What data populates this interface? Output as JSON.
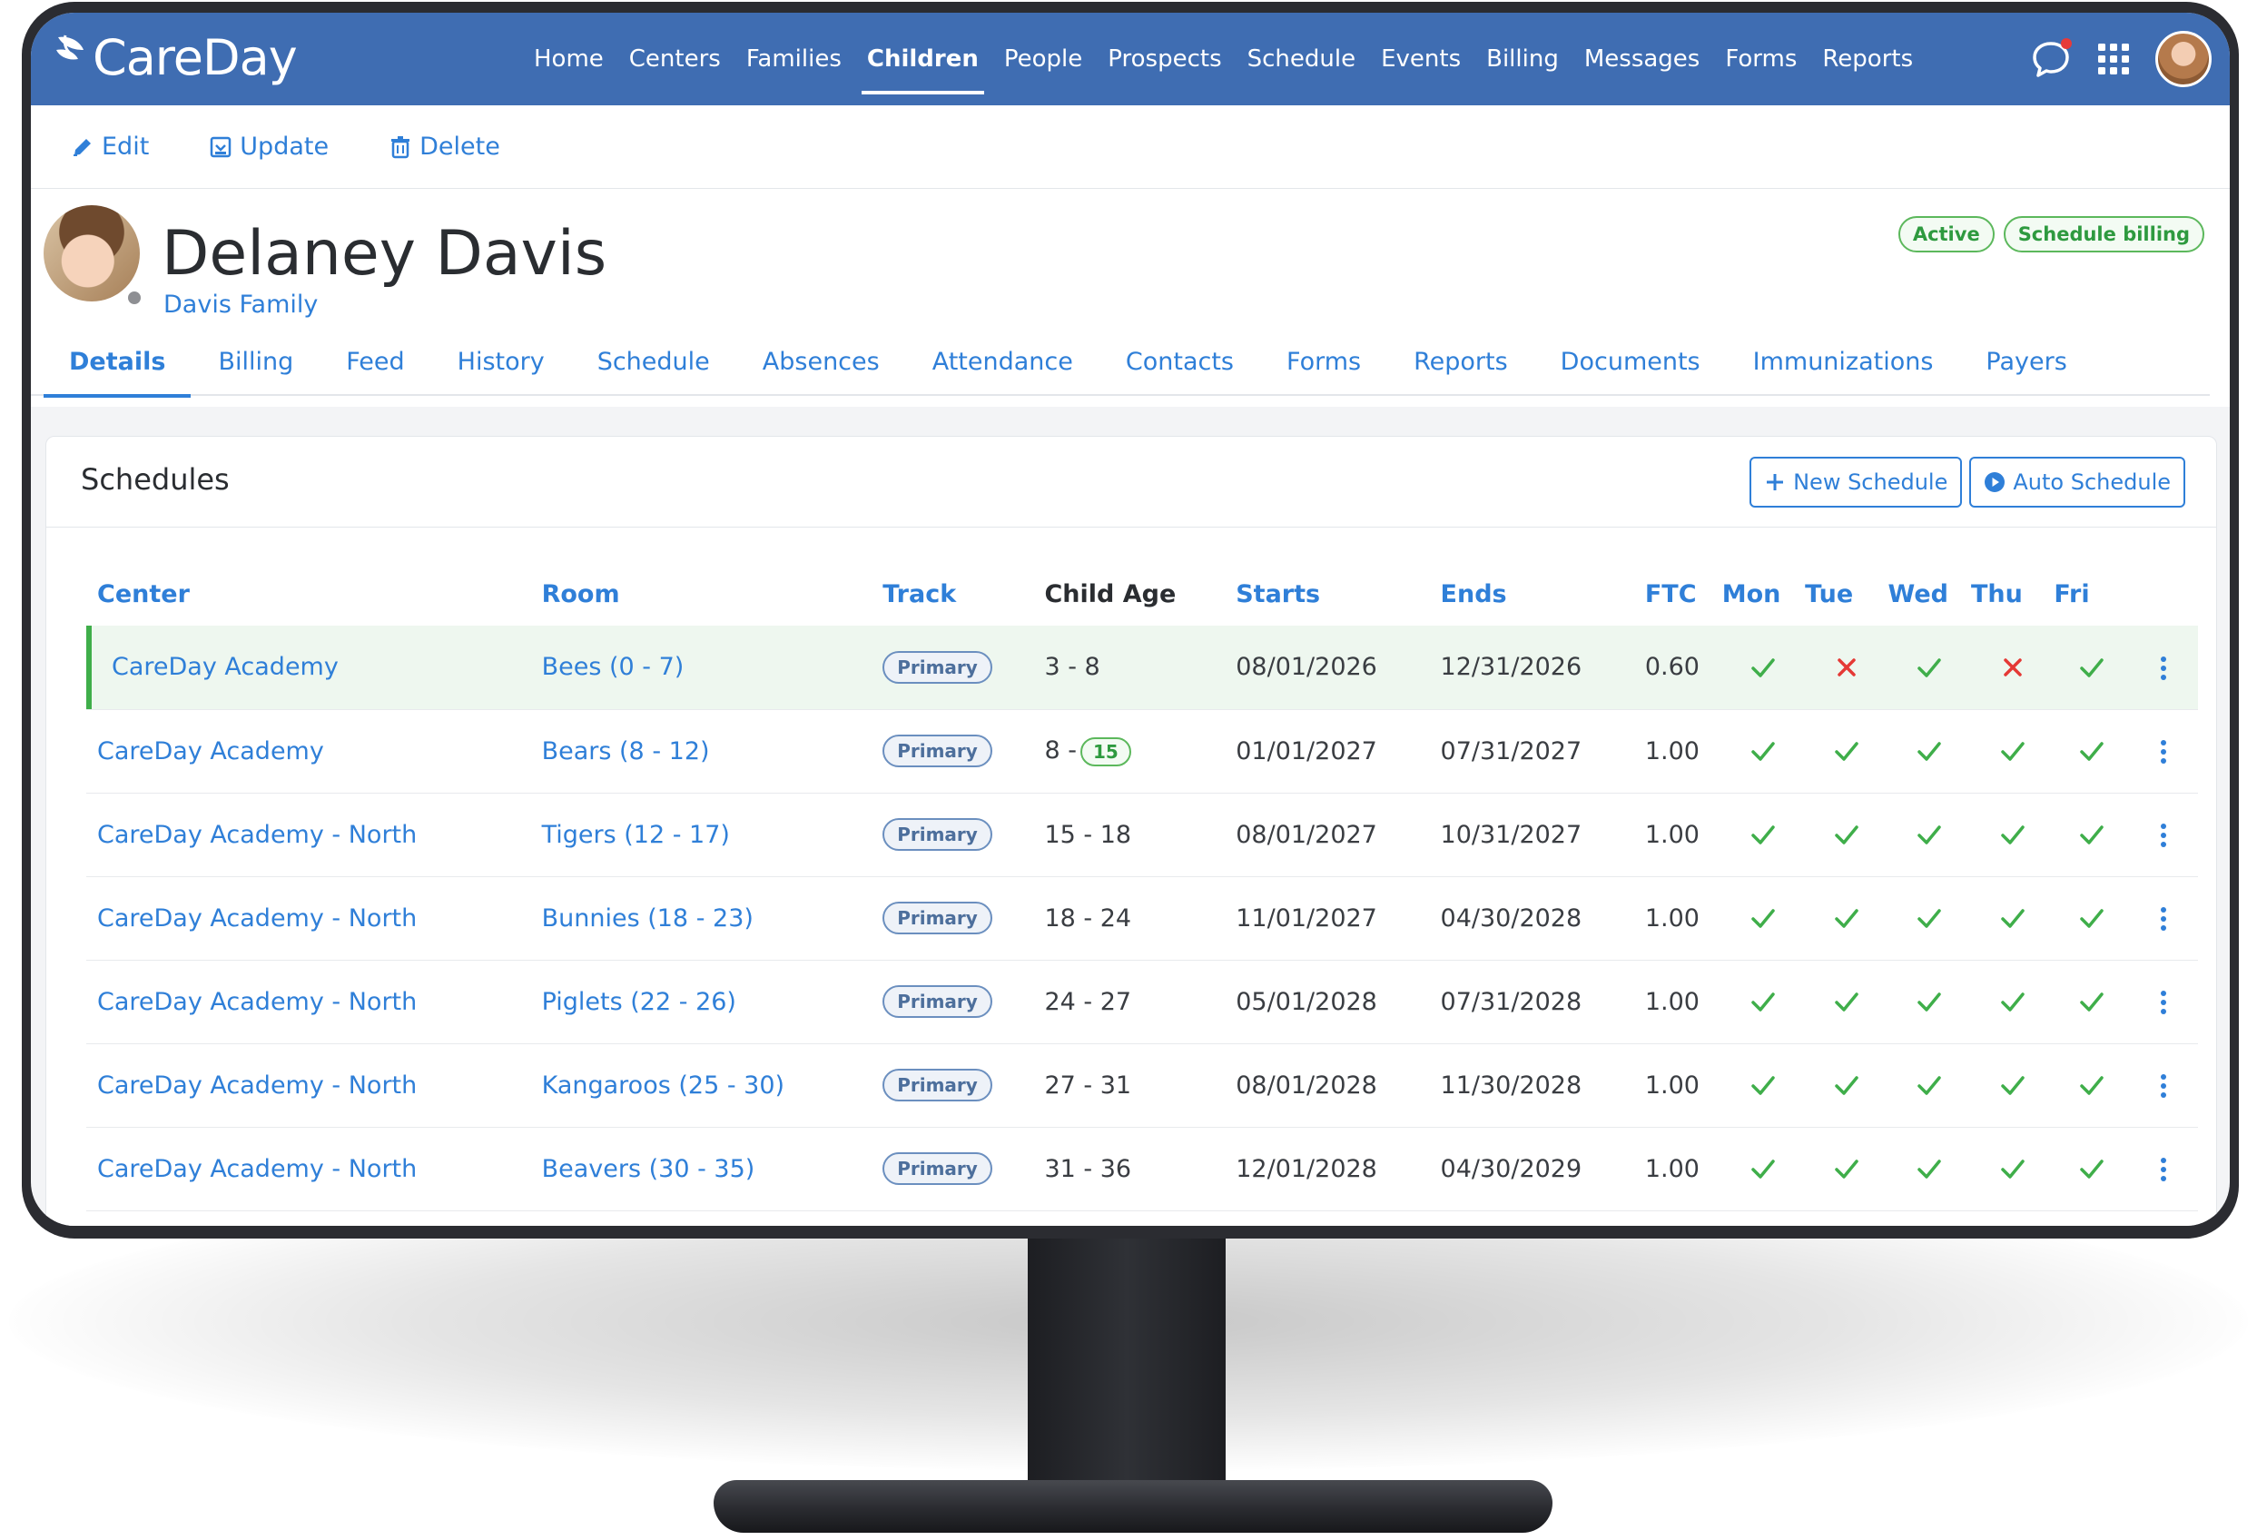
{
  "app": {
    "brand": "CareDay",
    "accent_color": "#3f6db2",
    "link_color": "#2f7fd8",
    "success_color": "#3fae4a",
    "danger_color": "#e53935"
  },
  "nav": {
    "items": [
      {
        "label": "Home",
        "active": false
      },
      {
        "label": "Centers",
        "active": false
      },
      {
        "label": "Families",
        "active": false
      },
      {
        "label": "Children",
        "active": true
      },
      {
        "label": "People",
        "active": false
      },
      {
        "label": "Prospects",
        "active": false
      },
      {
        "label": "Schedule",
        "active": false
      },
      {
        "label": "Events",
        "active": false
      },
      {
        "label": "Billing",
        "active": false
      },
      {
        "label": "Messages",
        "active": false
      },
      {
        "label": "Forms",
        "active": false
      },
      {
        "label": "Reports",
        "active": false
      }
    ],
    "icons": [
      "chat-icon",
      "apps-grid-icon",
      "user-avatar"
    ]
  },
  "actions": {
    "edit": "Edit",
    "update": "Update",
    "delete": "Delete"
  },
  "profile": {
    "name": "Delaney Davis",
    "family": "Davis Family",
    "badges": [
      "Active",
      "Schedule billing"
    ]
  },
  "subtabs": [
    {
      "label": "Details",
      "active": true
    },
    {
      "label": "Billing",
      "active": false
    },
    {
      "label": "Feed",
      "active": false
    },
    {
      "label": "History",
      "active": false
    },
    {
      "label": "Schedule",
      "active": false
    },
    {
      "label": "Absences",
      "active": false
    },
    {
      "label": "Attendance",
      "active": false
    },
    {
      "label": "Contacts",
      "active": false
    },
    {
      "label": "Forms",
      "active": false
    },
    {
      "label": "Reports",
      "active": false
    },
    {
      "label": "Documents",
      "active": false
    },
    {
      "label": "Immunizations",
      "active": false
    },
    {
      "label": "Payers",
      "active": false
    }
  ],
  "schedules": {
    "title": "Schedules",
    "new_button": "New Schedule",
    "auto_button": "Auto Schedule",
    "columns": [
      "Center",
      "Room",
      "Track",
      "Child Age",
      "Starts",
      "Ends",
      "FTC",
      "Mon",
      "Tue",
      "Wed",
      "Thu",
      "Fri"
    ],
    "rows": [
      {
        "center": "CareDay Academy",
        "room": "Bees (0 - 7)",
        "track": "Primary",
        "age": "3 - 8",
        "age_badge": "",
        "starts": "08/01/2026",
        "ends": "12/31/2026",
        "ftc": "0.60",
        "days": [
          true,
          false,
          true,
          false,
          true
        ],
        "highlight": true
      },
      {
        "center": "CareDay Academy",
        "room": "Bears (8 - 12)",
        "track": "Primary",
        "age": "8 -",
        "age_badge": "15",
        "starts": "01/01/2027",
        "ends": "07/31/2027",
        "ftc": "1.00",
        "days": [
          true,
          true,
          true,
          true,
          true
        ],
        "highlight": false
      },
      {
        "center": "CareDay Academy - North",
        "room": "Tigers (12 - 17)",
        "track": "Primary",
        "age": "15 - 18",
        "age_badge": "",
        "starts": "08/01/2027",
        "ends": "10/31/2027",
        "ftc": "1.00",
        "days": [
          true,
          true,
          true,
          true,
          true
        ],
        "highlight": false
      },
      {
        "center": "CareDay Academy - North",
        "room": "Bunnies (18 - 23)",
        "track": "Primary",
        "age": "18 - 24",
        "age_badge": "",
        "starts": "11/01/2027",
        "ends": "04/30/2028",
        "ftc": "1.00",
        "days": [
          true,
          true,
          true,
          true,
          true
        ],
        "highlight": false
      },
      {
        "center": "CareDay Academy - North",
        "room": "Piglets (22 - 26)",
        "track": "Primary",
        "age": "24 - 27",
        "age_badge": "",
        "starts": "05/01/2028",
        "ends": "07/31/2028",
        "ftc": "1.00",
        "days": [
          true,
          true,
          true,
          true,
          true
        ],
        "highlight": false
      },
      {
        "center": "CareDay Academy - North",
        "room": "Kangaroos (25 - 30)",
        "track": "Primary",
        "age": "27 - 31",
        "age_badge": "",
        "starts": "08/01/2028",
        "ends": "11/30/2028",
        "ftc": "1.00",
        "days": [
          true,
          true,
          true,
          true,
          true
        ],
        "highlight": false
      },
      {
        "center": "CareDay Academy - North",
        "room": "Beavers (30 - 35)",
        "track": "Primary",
        "age": "31 - 36",
        "age_badge": "",
        "starts": "12/01/2028",
        "ends": "04/30/2029",
        "ftc": "1.00",
        "days": [
          true,
          true,
          true,
          true,
          true
        ],
        "highlight": false
      }
    ]
  }
}
